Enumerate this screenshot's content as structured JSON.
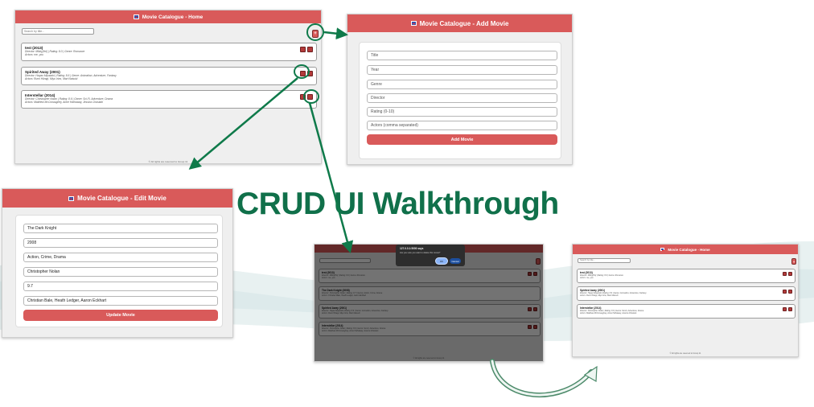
{
  "headline": "CRUD UI Walkthrough",
  "home": {
    "title": "Movie Catalogue - Home",
    "search_placeholder": "Search by title...",
    "add_label": "+",
    "footer": "© All rights are reserved to Group 11",
    "movies": [
      {
        "title": "test (2013)",
        "meta": "Director: Mikky[He] | Rating: 8.0 | Genre: Romance",
        "actors": "Actors: me, you"
      },
      {
        "title": "Spirited Away (2001)",
        "meta": "Director: Hayao Miyazaki | Rating: 8.6 | Genre: Animation, Adventure, Fantasy",
        "actors": "Actors: Rumi Hiiragi, Miyu Irino, Mari Natsuki"
      },
      {
        "title": "Interstellar (2014)",
        "meta": "Director: Christopher Nolan | Rating: 8.6 | Genre: Sci-Fi, Adventure, Drama",
        "actors": "Actors: Matthew McConaughey, Anne Hathaway, Jessica Chastain"
      }
    ]
  },
  "add": {
    "title": "Movie Catalogue - Add Movie",
    "fields": [
      "Title",
      "Year",
      "Genre",
      "Director",
      "Rating (0-10)",
      "Actors (comma separated)"
    ],
    "submit": "Add Movie"
  },
  "edit": {
    "title": "Movie Catalogue - Edit Movie",
    "fields": [
      "The Dark Knight",
      "2008",
      "Action, Crime, Drama",
      "Christopher Nolan",
      "9.7",
      "Christian Bale, Heath Ledger, Aaron Eckhart"
    ],
    "submit": "Update Movie"
  },
  "confirm": {
    "host": "127.0.0.1:5000 says",
    "message": "Are you sure you want to delete this movie?",
    "ok": "OK",
    "cancel": "Cancel",
    "movies": [
      {
        "title": "test (2013)",
        "meta": "Director: Mikky[He] | Rating: 8.0 | Genre: Romance",
        "actors": "Actors: me, you"
      },
      {
        "title": "The Dark Knight (2008)",
        "meta": "Director: Christopher Nolan | Rating: 9.7 | Genre: Action, Crime, Drama",
        "actors": "Actors: Christian Bale, Heath Ledger, Aaron Eckhart"
      },
      {
        "title": "Spirited Away (2001)",
        "meta": "Director: Hayao Miyazaki | Rating: 8.6 | Genre: Animation, Adventure, Fantasy",
        "actors": "Actors: Rumi Hiiragi, Miyu Irino, Mari Natsuki"
      },
      {
        "title": "Interstellar (2014)",
        "meta": "Director: Christopher Nolan | Rating: 8.6 | Genre: Sci-Fi, Adventure, Drama",
        "actors": "Actors: Matthew McConaughey, Anne Hathaway, Jessica Chastain"
      }
    ]
  },
  "colors": {
    "accent": "#d95a5a",
    "arrow": "#0f7a4a",
    "headline": "#10704a"
  },
  "icons": [
    "flag-icon",
    "edit-icon",
    "delete-icon",
    "arrow-icon"
  ]
}
